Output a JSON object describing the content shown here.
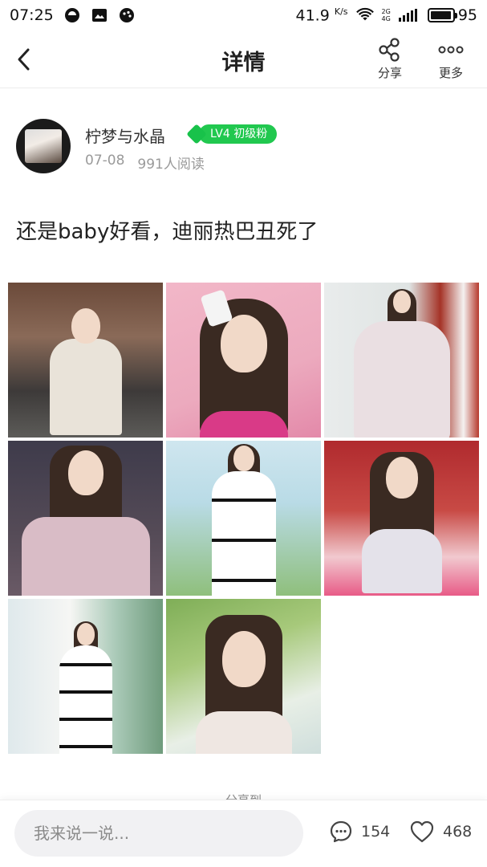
{
  "status_bar": {
    "time": "07:25",
    "net_speed": "41.9",
    "net_unit": "K/s",
    "network_2g": "2G",
    "network_4g": "4G",
    "battery": "95",
    "battery_level": 0.95
  },
  "header": {
    "title": "详情",
    "share_label": "分享",
    "more_label": "更多"
  },
  "post": {
    "author_name": "柠梦与水晶",
    "level_badge": "LV4 初级粉",
    "date": "07-08",
    "reads": "991人阅读",
    "text": "还是baby好看，迪丽热巴丑死了",
    "share_to": "分享到"
  },
  "photos": [
    {
      "name": "photo-1"
    },
    {
      "name": "photo-2"
    },
    {
      "name": "photo-3"
    },
    {
      "name": "photo-4"
    },
    {
      "name": "photo-5"
    },
    {
      "name": "photo-6"
    },
    {
      "name": "photo-7"
    },
    {
      "name": "photo-8"
    }
  ],
  "bottom_bar": {
    "comment_placeholder": "我来说一说...",
    "comment_count": "154",
    "like_count": "468"
  },
  "colors": {
    "accent_green": "#21c84f",
    "muted_text": "#9a9a9a"
  }
}
